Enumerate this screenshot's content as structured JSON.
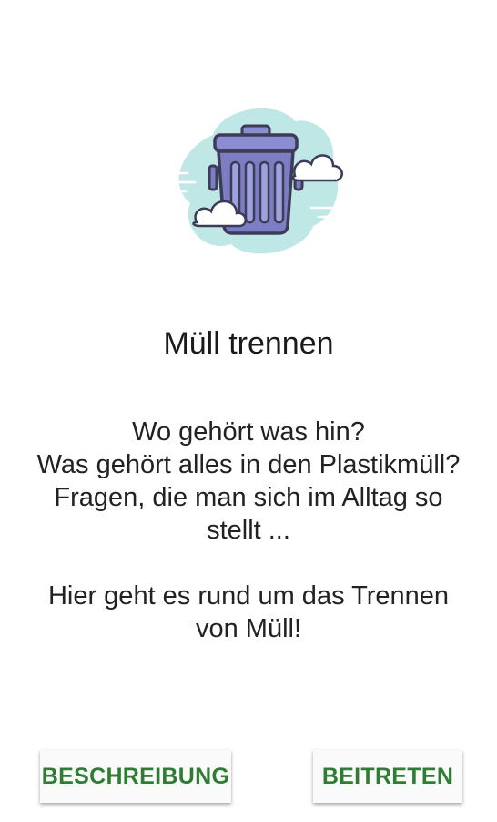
{
  "illustration": {
    "icon": "trash-can-icon",
    "colors": {
      "background_blob": "#bfe7e5",
      "can_body": "#7c7ec4",
      "can_outline": "#3d3b55",
      "cloud": "#ffffff"
    }
  },
  "main": {
    "title": "Müll trennen",
    "description": "Wo gehört was hin?\nWas gehört alles in den Plastikmüll?\nFragen, die man sich im Alltag so stellt ...\n\nHier geht es rund um das Trennen von Müll!"
  },
  "actions": {
    "description_label": "BESCHREIBUNG",
    "join_label": "BEITRETEN",
    "accent_color": "#2e7d32"
  }
}
